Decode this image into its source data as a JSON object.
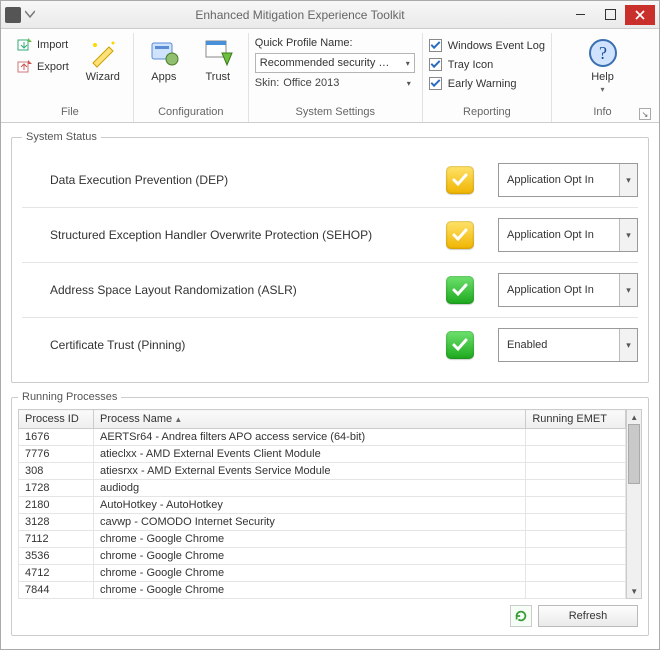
{
  "title": "Enhanced Mitigation Experience Toolkit",
  "ribbon": {
    "file": {
      "label": "File",
      "import": "Import",
      "export": "Export"
    },
    "config": {
      "label": "Configuration",
      "wizard": "Wizard",
      "apps": "Apps",
      "trust": "Trust"
    },
    "sysset": {
      "label": "System Settings",
      "quickProfile": "Quick Profile Name:",
      "profileValue": "Recommended security …",
      "skinLabel": "Skin:",
      "skinValue": "Office 2013"
    },
    "reporting": {
      "label": "Reporting",
      "eventlog": "Windows Event Log",
      "tray": "Tray Icon",
      "early": "Early Warning"
    },
    "info": {
      "label": "Info",
      "help": "Help"
    }
  },
  "status": {
    "legend": "System Status",
    "rows": [
      {
        "label": "Data Execution Prevention (DEP)",
        "state": "yellow",
        "value": "Application Opt In"
      },
      {
        "label": "Structured Exception Handler Overwrite Protection (SEHOP)",
        "state": "yellow",
        "value": "Application Opt In"
      },
      {
        "label": "Address Space Layout Randomization (ASLR)",
        "state": "green",
        "value": "Application Opt In"
      },
      {
        "label": "Certificate Trust (Pinning)",
        "state": "green",
        "value": "Enabled"
      }
    ]
  },
  "procs": {
    "legend": "Running Processes",
    "cols": {
      "pid": "Process ID",
      "name": "Process Name",
      "emet": "Running EMET"
    },
    "rows": [
      {
        "pid": "1676",
        "name": "AERTSr64 - Andrea filters APO access service (64-bit)"
      },
      {
        "pid": "7776",
        "name": "atieclxx - AMD External Events Client Module"
      },
      {
        "pid": "308",
        "name": "atiesrxx - AMD External Events Service Module"
      },
      {
        "pid": "1728",
        "name": "audiodg"
      },
      {
        "pid": "2180",
        "name": "AutoHotkey - AutoHotkey"
      },
      {
        "pid": "3128",
        "name": "cavwp - COMODO Internet Security"
      },
      {
        "pid": "7112",
        "name": "chrome - Google Chrome"
      },
      {
        "pid": "3536",
        "name": "chrome - Google Chrome"
      },
      {
        "pid": "4712",
        "name": "chrome - Google Chrome"
      },
      {
        "pid": "7844",
        "name": "chrome - Google Chrome"
      }
    ],
    "refresh": "Refresh"
  }
}
